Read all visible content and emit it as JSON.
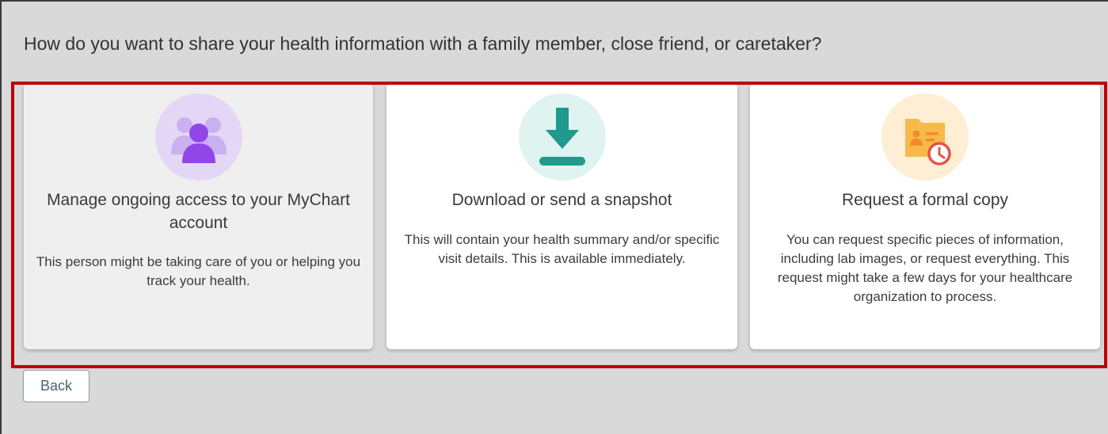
{
  "page": {
    "question": "How do you want to share your health information with a family member, close friend, or caretaker?"
  },
  "options": [
    {
      "icon": "group-of-people-icon",
      "title": "Manage ongoing access to your MyChart account",
      "description": "This person might be taking care of you or helping you track your health.",
      "selected": true
    },
    {
      "icon": "download-icon",
      "title": "Download or send a snapshot",
      "description": "This will contain your health summary and/or specific visit details. This is available immediately."
    },
    {
      "icon": "folder-clock-icon",
      "title": "Request a formal copy",
      "description": "You can request specific pieces of information, including lab images, or request everything. This request might take a few days for your healthcare organization to process."
    }
  ],
  "actions": {
    "back_label": "Back"
  },
  "colors": {
    "highlight_border": "#c00000",
    "people_icon_purple": "#9146e8",
    "download_icon_teal": "#1f9a8c",
    "folder_icon_orange": "#f7b94a",
    "clock_icon_red": "#e5534b"
  }
}
